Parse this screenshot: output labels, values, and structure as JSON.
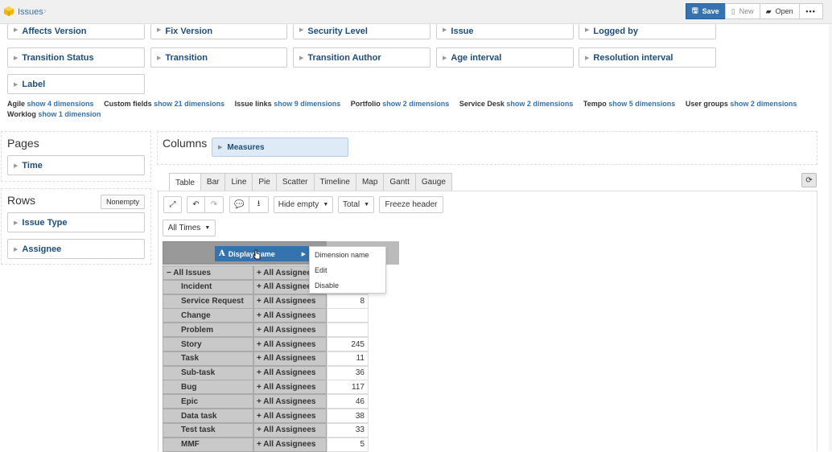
{
  "header": {
    "breadcrumb": "Issues",
    "chevron": "›",
    "save_label": "Save",
    "new_label": "New",
    "open_label": "Open",
    "more_label": "•••"
  },
  "dimensions": {
    "row1": [
      "Affects Version",
      "Fix Version",
      "Security Level",
      "Issue",
      "Logged by"
    ],
    "row2": [
      "Transition Status",
      "Transition",
      "Transition Author",
      "Age interval",
      "Resolution interval"
    ],
    "row3": [
      "Label"
    ]
  },
  "dim_groups": [
    {
      "name": "Agile",
      "link": "show 4 dimensions"
    },
    {
      "name": "Custom fields",
      "link": "show 21 dimensions"
    },
    {
      "name": "Issue links",
      "link": "show 9 dimensions"
    },
    {
      "name": "Portfolio",
      "link": "show 2 dimensions"
    },
    {
      "name": "Service Desk",
      "link": "show 2 dimensions"
    },
    {
      "name": "Tempo",
      "link": "show 5 dimensions"
    },
    {
      "name": "User groups",
      "link": "show 2 dimensions"
    },
    {
      "name": "Worklog",
      "link": "show 1 dimension"
    }
  ],
  "pages": {
    "title": "Pages",
    "items": [
      "Time"
    ]
  },
  "rows_panel": {
    "title": "Rows",
    "nonempty_label": "Nonempty",
    "items": [
      "Issue Type",
      "Assignee"
    ]
  },
  "columns_panel": {
    "title": "Columns",
    "items": [
      "Measures"
    ]
  },
  "tabs": [
    "Table",
    "Bar",
    "Line",
    "Pie",
    "Scatter",
    "Timeline",
    "Map",
    "Gantt",
    "Gauge"
  ],
  "active_tab": "Table",
  "toolbar": {
    "hide_empty": "Hide empty",
    "total": "Total",
    "freeze_header": "Freeze header",
    "all_times": "All Times"
  },
  "context": {
    "display_name": "Display name",
    "menu": [
      "Dimension name",
      "Edit",
      "Disable"
    ]
  },
  "table": {
    "rows": [
      {
        "a": "− All Issues",
        "b": "+ All Assignees",
        "c": "",
        "parent": true
      },
      {
        "a": "Incident",
        "b": "+ All Assignees",
        "c": ""
      },
      {
        "a": "Service Request",
        "b": "+ All Assignees",
        "c": "8"
      },
      {
        "a": "Change",
        "b": "+ All Assignees",
        "c": ""
      },
      {
        "a": "Problem",
        "b": "+ All Assignees",
        "c": ""
      },
      {
        "a": "Story",
        "b": "+ All Assignees",
        "c": "245"
      },
      {
        "a": "Task",
        "b": "+ All Assignees",
        "c": "11"
      },
      {
        "a": "Sub-task",
        "b": "+ All Assignees",
        "c": "36"
      },
      {
        "a": "Bug",
        "b": "+ All Assignees",
        "c": "117"
      },
      {
        "a": "Epic",
        "b": "+ All Assignees",
        "c": "46"
      },
      {
        "a": "Data task",
        "b": "+ All Assignees",
        "c": "38"
      },
      {
        "a": "Test task",
        "b": "+ All Assignees",
        "c": "33"
      },
      {
        "a": "MMF",
        "b": "+ All Assignees",
        "c": "5"
      }
    ]
  }
}
